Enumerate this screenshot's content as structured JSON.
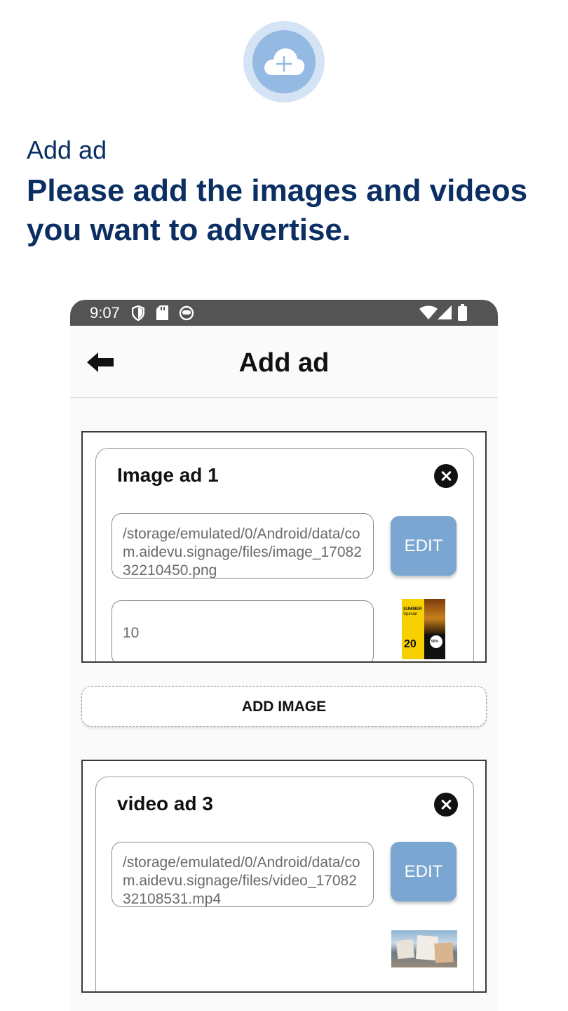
{
  "promo": {
    "subtitle": "Add ad",
    "headline": "Please add the images and videos you want to advertise.",
    "icon": "cloud-plus-icon"
  },
  "status_bar": {
    "time": "9:07",
    "icons": [
      "shield-icon",
      "sd-card-icon",
      "face-icon",
      "wifi-icon",
      "signal-icon",
      "battery-icon"
    ]
  },
  "app_bar": {
    "title": "Add ad",
    "back_icon": "arrow-left-icon"
  },
  "ads": [
    {
      "title": "Image ad 1",
      "path": "/storage/emulated/0/Android/data/com.aidevu.signage/files/image_1708232210450.png",
      "edit_label": "EDIT",
      "duration": "10",
      "thumb": {
        "l1": "SUMMER",
        "l2": "Special",
        "big": "20",
        "pct": "50%"
      }
    },
    {
      "title": "video ad 3",
      "path": "/storage/emulated/0/Android/data/com.aidevu.signage/files/video_1708232108531.mp4",
      "edit_label": "EDIT"
    }
  ],
  "add_image_label": "ADD IMAGE",
  "colors": {
    "navy": "#0b2f63",
    "edit_button": "#7ba6d1",
    "status_bar": "#545454"
  }
}
